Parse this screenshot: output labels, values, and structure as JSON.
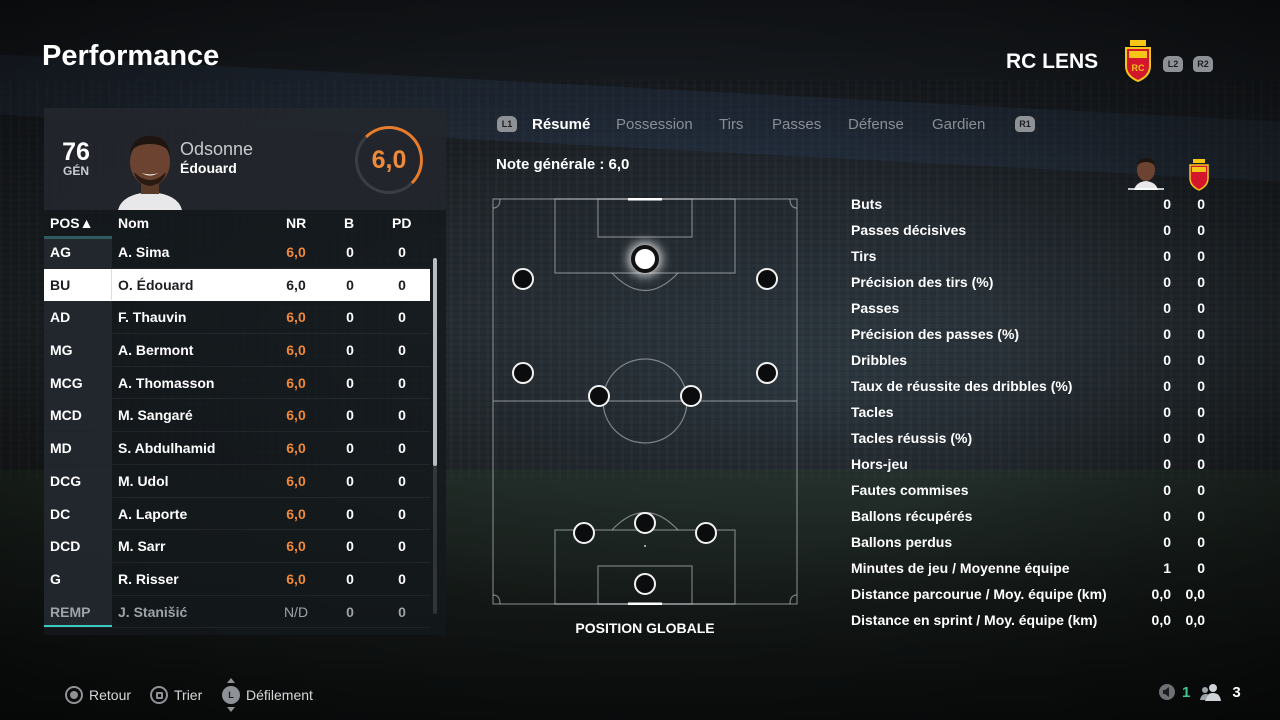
{
  "header": {
    "title": "Performance",
    "club": "RC LENS",
    "l2": "L2",
    "r2": "R2"
  },
  "player": {
    "overall": "76",
    "overall_label": "GÉN",
    "last_name": "Odsonne",
    "first_name": "Édouard",
    "rating": "6,0"
  },
  "table": {
    "headers": {
      "pos": "POS▲",
      "name": "Nom",
      "nr": "NR",
      "b": "B",
      "pd": "PD"
    },
    "rows": [
      {
        "pos": "AG",
        "name": "A. Sima",
        "nr": "6,0",
        "b": "0",
        "pd": "0"
      },
      {
        "pos": "BU",
        "name": "O. Édouard",
        "nr": "6,0",
        "b": "0",
        "pd": "0",
        "selected": true
      },
      {
        "pos": "AD",
        "name": "F. Thauvin",
        "nr": "6,0",
        "b": "0",
        "pd": "0"
      },
      {
        "pos": "MG",
        "name": "A. Bermont",
        "nr": "6,0",
        "b": "0",
        "pd": "0"
      },
      {
        "pos": "MCG",
        "name": "A. Thomasson",
        "nr": "6,0",
        "b": "0",
        "pd": "0"
      },
      {
        "pos": "MCD",
        "name": "M. Sangaré",
        "nr": "6,0",
        "b": "0",
        "pd": "0"
      },
      {
        "pos": "MD",
        "name": "S. Abdulhamid",
        "nr": "6,0",
        "b": "0",
        "pd": "0"
      },
      {
        "pos": "DCG",
        "name": "M. Udol",
        "nr": "6,0",
        "b": "0",
        "pd": "0"
      },
      {
        "pos": "DC",
        "name": "A. Laporte",
        "nr": "6,0",
        "b": "0",
        "pd": "0"
      },
      {
        "pos": "DCD",
        "name": "M. Sarr",
        "nr": "6,0",
        "b": "0",
        "pd": "0"
      },
      {
        "pos": "G",
        "name": "R. Risser",
        "nr": "6,0",
        "b": "0",
        "pd": "0"
      },
      {
        "pos": "REMP",
        "name": "J. Stanišić",
        "nr": "N/D",
        "b": "0",
        "pd": "0",
        "sub": true
      }
    ]
  },
  "tabs": {
    "l1": "L1",
    "r1": "R1",
    "items": [
      "Résumé",
      "Possession",
      "Tirs",
      "Passes",
      "Défense",
      "Gardien"
    ],
    "active": "Résumé"
  },
  "summary": {
    "overall_rating": "Note générale : 6,0",
    "field_caption": "POSITION GLOBALE"
  },
  "stats": [
    {
      "label": "Buts",
      "player": "0",
      "team": "0"
    },
    {
      "label": "Passes décisives",
      "player": "0",
      "team": "0"
    },
    {
      "label": "Tirs",
      "player": "0",
      "team": "0"
    },
    {
      "label": "Précision des tirs (%)",
      "player": "0",
      "team": "0"
    },
    {
      "label": "Passes",
      "player": "0",
      "team": "0"
    },
    {
      "label": "Précision des passes (%)",
      "player": "0",
      "team": "0"
    },
    {
      "label": "Dribbles",
      "player": "0",
      "team": "0"
    },
    {
      "label": "Taux de réussite des dribbles (%)",
      "player": "0",
      "team": "0"
    },
    {
      "label": "Tacles",
      "player": "0",
      "team": "0"
    },
    {
      "label": "Tacles réussis (%)",
      "player": "0",
      "team": "0"
    },
    {
      "label": "Hors-jeu",
      "player": "0",
      "team": "0"
    },
    {
      "label": "Fautes commises",
      "player": "0",
      "team": "0"
    },
    {
      "label": "Ballons récupérés",
      "player": "0",
      "team": "0"
    },
    {
      "label": "Ballons perdus",
      "player": "0",
      "team": "0"
    },
    {
      "label": "Minutes de jeu / Moyenne équipe",
      "player": "1",
      "team": "0"
    },
    {
      "label": "Distance parcourue / Moy. équipe (km)",
      "player": "0,0",
      "team": "0,0"
    },
    {
      "label": "Distance en sprint / Moy. équipe (km)",
      "player": "0,0",
      "team": "0,0"
    }
  ],
  "footer": {
    "back": "Retour",
    "sort": "Trier",
    "scroll": "Défilement",
    "stick_label": "L",
    "count_a": "1",
    "count_b": "3"
  },
  "colors": {
    "accent": "#3ec9c0",
    "rating": "#f08a3a",
    "lens_red": "#d3162b",
    "lens_yellow": "#f5c518"
  }
}
